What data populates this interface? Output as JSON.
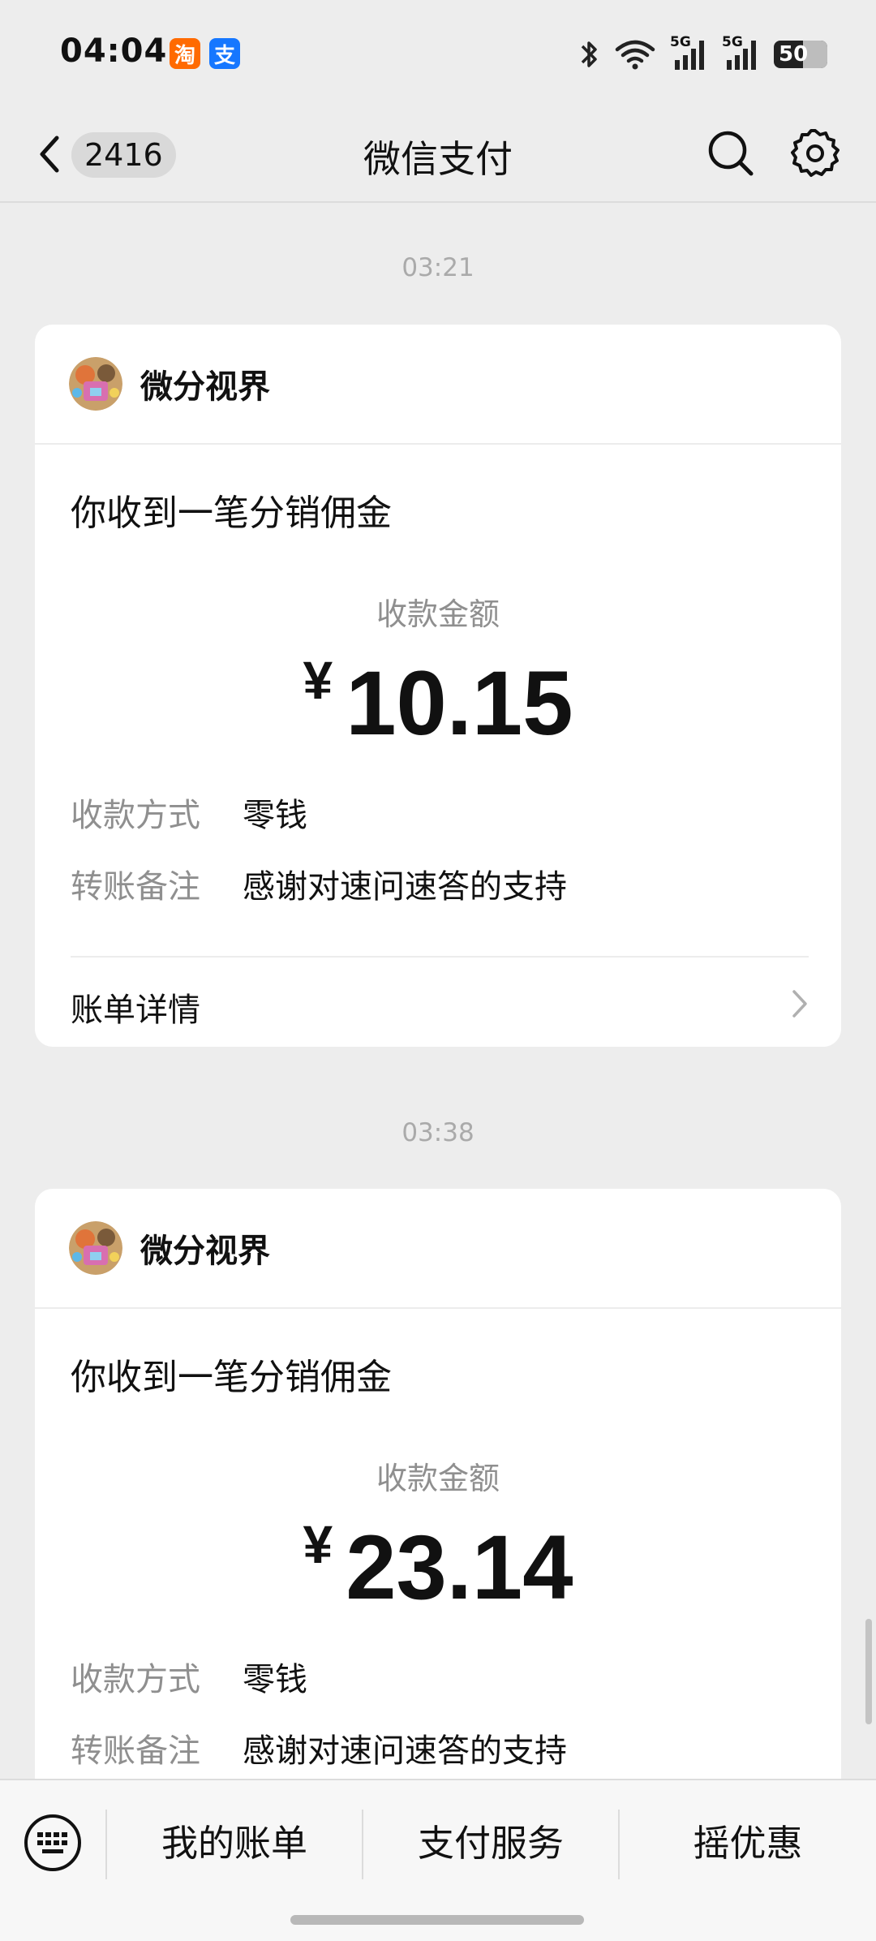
{
  "status_bar": {
    "time": "04:04",
    "app_badges": [
      {
        "icon": "taobao-icon",
        "glyph": "淘",
        "color": "#ff6a00"
      },
      {
        "icon": "alipay-icon",
        "glyph": "支",
        "color": "#1677ff"
      }
    ],
    "network_1": "5G",
    "network_2": "5G",
    "battery": "50"
  },
  "header": {
    "unread_count": "2416",
    "title": "微信支付"
  },
  "messages": [
    {
      "time": "03:21",
      "sender": "微分视界",
      "title": "你收到一笔分销佣金",
      "amount_label": "收款金额",
      "currency": "¥",
      "amount": "10.15",
      "method_label": "收款方式",
      "method_value": "零钱",
      "memo_label": "转账备注",
      "memo_value": "感谢对速问速答的支持",
      "details_label": "账单详情"
    },
    {
      "time": "03:38",
      "sender": "微分视界",
      "title": "你收到一笔分销佣金",
      "amount_label": "收款金额",
      "currency": "¥",
      "amount": "23.14",
      "method_label": "收款方式",
      "method_value": "零钱",
      "memo_label": "转账备注",
      "memo_value": "感谢对速问速答的支持"
    }
  ],
  "bottom_menu": {
    "keyboard_icon": "keyboard-icon",
    "items": [
      "我的账单",
      "支付服务",
      "摇优惠"
    ]
  },
  "colors": {
    "background": "#ededed",
    "card": "#ffffff",
    "secondary_text": "#8f8f8f"
  }
}
